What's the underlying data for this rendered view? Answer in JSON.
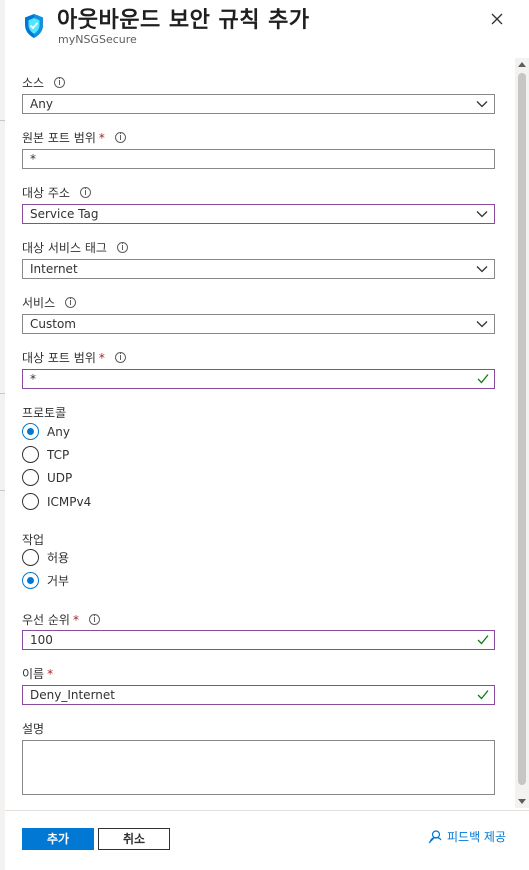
{
  "header": {
    "title": "아웃바운드 보안 규칙 추가",
    "subtitle": "myNSGSecure",
    "icons": {
      "resource": "shield-icon",
      "close": "close-icon"
    }
  },
  "form": {
    "source": {
      "label": "소스",
      "value": "Any"
    },
    "source_port": {
      "label": "원본 포트 범위",
      "required_mark": "*",
      "value": "*"
    },
    "destination": {
      "label": "대상 주소",
      "value": "Service Tag"
    },
    "destination_service_tag": {
      "label": "대상 서비스 태그",
      "value": "Internet"
    },
    "service": {
      "label": "서비스",
      "value": "Custom"
    },
    "destination_port": {
      "label": "대상 포트 범위",
      "required_mark": "*",
      "value": "*"
    },
    "protocol": {
      "label": "프로토콜",
      "options": [
        "Any",
        "TCP",
        "UDP",
        "ICMPv4"
      ],
      "selected": "Any"
    },
    "action": {
      "label": "작업",
      "options": [
        "허용",
        "거부"
      ],
      "selected": "거부"
    },
    "priority": {
      "label": "우선 순위",
      "required_mark": "*",
      "value": "100"
    },
    "name": {
      "label": "이름",
      "required_mark": "*",
      "value": "Deny_Internet"
    },
    "description": {
      "label": "설명",
      "value": ""
    }
  },
  "footer": {
    "add_label": "추가",
    "cancel_label": "취소",
    "feedback_label": "피드백 제공"
  },
  "colors": {
    "accent": "#0078d4",
    "focus_border": "#8a4b9e",
    "valid_check": "#107c10",
    "required": "#a4262c"
  }
}
